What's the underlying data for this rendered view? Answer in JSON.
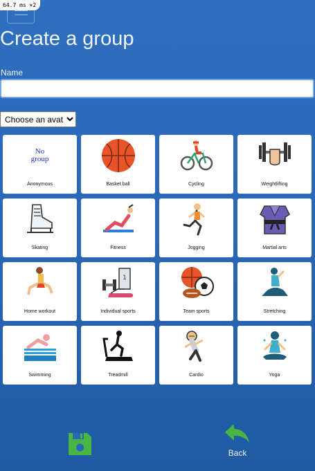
{
  "debug": {
    "timing": "64.7 ms ×2"
  },
  "page": {
    "title": "Create a group"
  },
  "form": {
    "name_label": "Name",
    "name_value": "",
    "avatar_select": {
      "selected": "Choose an avatar"
    }
  },
  "avatars": [
    {
      "label": "Anonymous",
      "placeholder_text": "No group",
      "icon": "no-group-text"
    },
    {
      "label": "Basket ball",
      "icon": "basketball-icon"
    },
    {
      "label": "Cycling",
      "icon": "cyclist-icon"
    },
    {
      "label": "Weightlifting",
      "icon": "weightlifting-icon"
    },
    {
      "label": "Skating",
      "icon": "ice-skate-icon"
    },
    {
      "label": "Fitness",
      "icon": "fitness-icon"
    },
    {
      "label": "Jogging",
      "icon": "jogging-icon"
    },
    {
      "label": "Martial arts",
      "icon": "martial-arts-icon"
    },
    {
      "label": "Home workout",
      "icon": "home-workout-icon"
    },
    {
      "label": "Individual sports",
      "icon": "individual-sports-icon"
    },
    {
      "label": "Team sports",
      "icon": "team-sports-icon"
    },
    {
      "label": "Stretching",
      "icon": "stretching-icon"
    },
    {
      "label": "Swimming",
      "icon": "swimming-icon"
    },
    {
      "label": "Treadmill",
      "icon": "treadmill-icon"
    },
    {
      "label": "Cardio",
      "icon": "cardio-icon"
    },
    {
      "label": "Yoga",
      "icon": "yoga-icon"
    }
  ],
  "actions": {
    "save_icon": "floppy-disk-icon",
    "back_label": "Back",
    "back_icon": "reply-arrow-icon"
  },
  "colors": {
    "background": "#2a67b6",
    "save": "#4bb543",
    "back": "#4bb543",
    "input_focus": "#6fa8ef"
  }
}
